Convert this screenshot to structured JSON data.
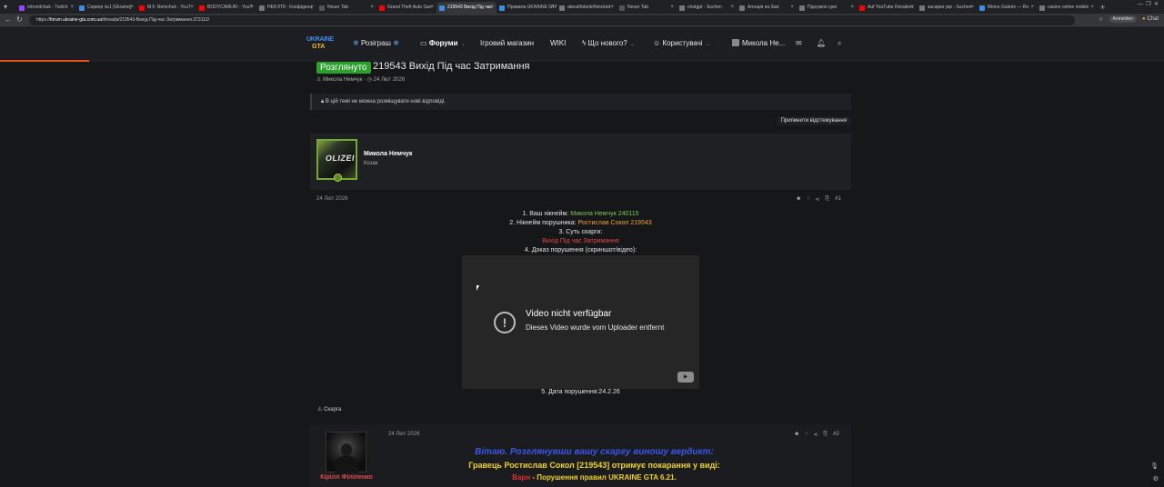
{
  "browser": {
    "tabs": [
      {
        "title": "mtrsmtchuk - Twitch",
        "color": "#9146ff",
        "active": false
      },
      {
        "title": "Сервер №1 [Ukraine]",
        "color": "#3a8ee6",
        "active": false
      },
      {
        "title": "M.F. Nemchuk - YouT",
        "color": "#ff0000",
        "active": false
      },
      {
        "title": "BODYCAMUKI - YouT",
        "color": "#ff0000",
        "active": false
      },
      {
        "title": "НЕ8 8Т8 - Конфіденц",
        "color": "#777777",
        "active": false
      },
      {
        "title": "Neuer Tab",
        "color": "#555555",
        "active": false
      },
      {
        "title": "Grand Theft Auto San",
        "color": "#ff0000",
        "active": false
      },
      {
        "title": "219543 Вихід Під час",
        "color": "#3a8ee6",
        "active": true
      },
      {
        "title": "Правила UKRAINE GTA",
        "color": "#3a8ee6",
        "active": false
      },
      {
        "title": "abouthblank#blocked",
        "color": "#777777",
        "active": false
      },
      {
        "title": "Neuer Tab",
        "color": "#555555",
        "active": false
      },
      {
        "title": "chatgpt - Suchen",
        "color": "#777777",
        "active": false
      },
      {
        "title": "Агенція на базі",
        "color": "#777777",
        "active": false
      },
      {
        "title": "Підсумок сумі",
        "color": "#777777",
        "active": false
      },
      {
        "title": "Auf YouTube Donation",
        "color": "#ff0000",
        "active": false
      },
      {
        "title": "засарки укр - Suchen",
        "color": "#777777",
        "active": false
      },
      {
        "title": "Meine Galerie — Ro",
        "color": "#3a8ee6",
        "active": false
      },
      {
        "title": "casino online mobile",
        "color": "#777777",
        "active": false
      }
    ],
    "url_host": "forum.ukraine-gta.com.ua",
    "url_path": "/threads/219543-Вихід-Під-час-Затримання.373112/",
    "url_prefix": "https://",
    "profile_label": "Anmelden",
    "chat_label": "Chat"
  },
  "header": {
    "logo_top": "UKRAINE",
    "logo_bottom": "GTA",
    "nav": {
      "giveaway": "Розіграш",
      "forums": "Форуми",
      "shop": "Ігровий магазин",
      "wiki": "WIKI",
      "whats_new": "Що нового?",
      "users": "Користувачі",
      "account": "Микола Не..."
    }
  },
  "thread": {
    "status_badge": "Розглянуто",
    "title": "219543 Вихід Під час Затримання",
    "author": "Микола Немчук",
    "date": "24 Лют 2026",
    "locked_notice": "В цій темі не можна розміщувати нові відповіді.",
    "watch_button": "Припинити відстежування"
  },
  "post1": {
    "author_name": "Микола Немчук",
    "author_title": "Козак",
    "avatar_text": "OLIZEI",
    "date": "24 Лют 2026",
    "number": "#1",
    "line1_label": "1. Ваш нікнейм:",
    "line1_value": "Микола Немчук 240115",
    "line2_label": "2. Нікнейм порушника:",
    "line2_value": "Ростислав Сокол 219543",
    "line3_label": "3. Суть скарги:",
    "line3_value": "Вихід Під час Затримання",
    "line4_label": "4. Доказ порушення (скриншот/відео):",
    "video_title": "Video nicht verfügbar",
    "video_subtitle": "Dieses Video wurde vom Uploader entfernt",
    "line5": "5. Дата порушення:24.2.26",
    "report": "Скарга"
  },
  "post2": {
    "author_name": "Кірілл Філіпенко",
    "date": "24 Лют 2026",
    "number": "#2",
    "verdict_line1": "Вітаю. Розглянувши вашу скаргу виношу вердикт:",
    "verdict_line2": "Гравець Ростислав Сокол [219543] отримує покарання у виді:",
    "verdict_warn": "Варн",
    "verdict_rest": " - Порушення правил UKRAINE GTA 6.21."
  }
}
